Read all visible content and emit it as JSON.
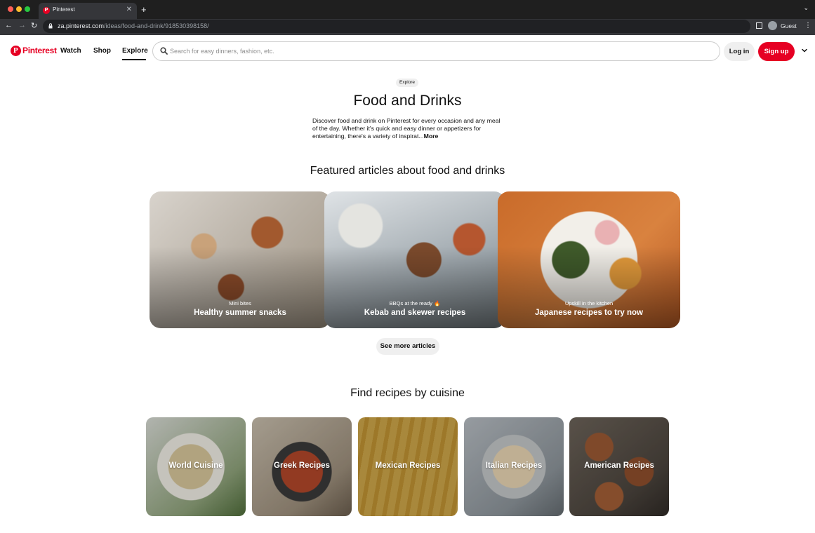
{
  "browser": {
    "tab_title": "Pinterest",
    "tab_close": "✕",
    "new_tab": "+",
    "url_host": "za.pinterest.com",
    "url_path": "/ideas/food-and-drink/918530398158/",
    "profile_label": "Guest"
  },
  "header": {
    "logo_text": "Pinterest",
    "nav": {
      "watch": "Watch",
      "shop": "Shop",
      "explore": "Explore"
    },
    "search_placeholder": "Search for easy dinners, fashion, etc.",
    "login_label": "Log in",
    "signup_label": "Sign up"
  },
  "hero": {
    "breadcrumb": "Explore",
    "title": "Food and Drinks",
    "description": "Discover food and drink on Pinterest for every occasion and any meal of the day. Whether it's quick and easy dinner or appetizers for entertaining, there's a variety of inspirat...",
    "more_label": "More"
  },
  "featured": {
    "title": "Featured articles about food and drinks",
    "articles": [
      {
        "kicker": "Mini bites",
        "headline": "Healthy summer snacks"
      },
      {
        "kicker": "BBQs at the ready 🔥",
        "headline": "Kebab and skewer recipes"
      },
      {
        "kicker": "Upskill in the kitchen",
        "headline": "Japanese recipes to try now"
      }
    ],
    "see_more_label": "See more articles"
  },
  "cuisine": {
    "title": "Find recipes by cuisine",
    "tiles": [
      {
        "label": "World Cuisine"
      },
      {
        "label": "Greek Recipes"
      },
      {
        "label": "Mexican Recipes"
      },
      {
        "label": "Italian Recipes"
      },
      {
        "label": "American Recipes"
      }
    ]
  },
  "colors": {
    "brand": "#e60023",
    "chrome_dark": "#202124",
    "chip_gray": "#efefef"
  },
  "icons": [
    "back-arrow-icon",
    "forward-arrow-icon",
    "reload-icon",
    "lock-icon",
    "search-icon",
    "chevron-down-icon",
    "side-panel-icon",
    "profile-avatar-icon",
    "more-menu-icon"
  ]
}
